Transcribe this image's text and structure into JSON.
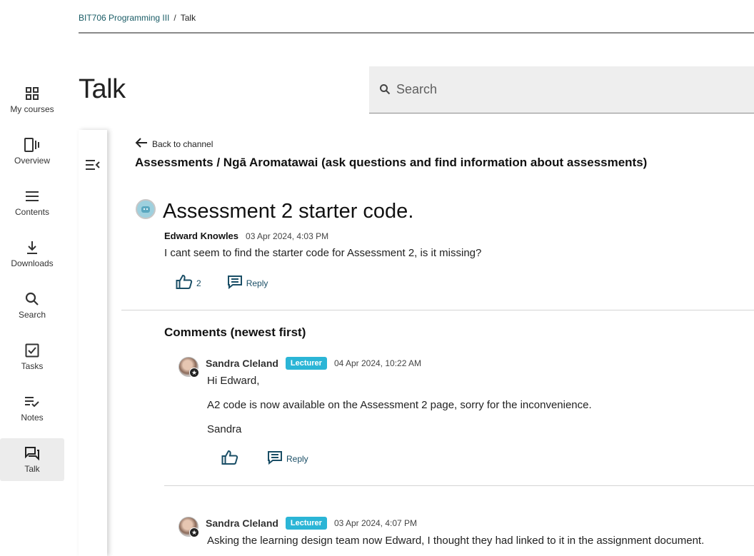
{
  "breadcrumb": {
    "course": "BIT706 Programming III",
    "separator": "/",
    "current": "Talk"
  },
  "sidebar": {
    "items": [
      {
        "label": "My courses",
        "icon": "grid-icon"
      },
      {
        "label": "Overview",
        "icon": "overview-icon"
      },
      {
        "label": "Contents",
        "icon": "menu-icon"
      },
      {
        "label": "Downloads",
        "icon": "download-icon"
      },
      {
        "label": "Search",
        "icon": "search-icon"
      },
      {
        "label": "Tasks",
        "icon": "checkbox-icon"
      },
      {
        "label": "Notes",
        "icon": "notes-icon"
      },
      {
        "label": "Talk",
        "icon": "chat-icon"
      }
    ],
    "active": "Talk"
  },
  "page": {
    "title": "Talk"
  },
  "search": {
    "placeholder": "Search"
  },
  "thread": {
    "back_label": "Back to channel",
    "channel_title": "Assessments / Ngā Aromatawai (ask questions and find information about assessments)",
    "post": {
      "title": "Assessment 2 starter code.",
      "author": "Edward Knowles",
      "timestamp": "03 Apr 2024, 4:03 PM",
      "body": "I cant seem to find the starter code for Assessment 2, is it missing?",
      "like_count": "2",
      "reply_label": "Reply"
    }
  },
  "comments": {
    "heading": "Comments (newest first)",
    "items": [
      {
        "author": "Sandra Cleland",
        "role": "Lecturer",
        "timestamp": "04 Apr 2024, 10:22 AM",
        "lines": [
          "Hi Edward,",
          "A2 code is now available on the Assessment 2 page, sorry for the inconvenience.",
          "Sandra"
        ],
        "reply_label": "Reply"
      },
      {
        "author": "Sandra Cleland",
        "role": "Lecturer",
        "timestamp": "03 Apr 2024, 4:07 PM",
        "lines": [
          "Asking the learning design team now Edward, I thought they had linked to it in the assignment document."
        ]
      }
    ]
  },
  "colors": {
    "accent": "#2bb5d6",
    "link": "#1a5c66",
    "action": "#1a4e66",
    "active_nav": "#ececec"
  }
}
